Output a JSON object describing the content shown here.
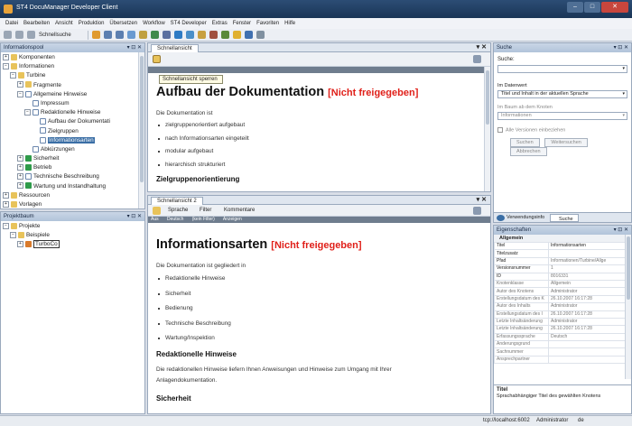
{
  "window": {
    "title": "ST4 DocuManager Developer Client"
  },
  "menu": [
    "Datei",
    "Bearbeiten",
    "Ansicht",
    "Produktion",
    "Übersetzen",
    "Workflow",
    "ST4 Developer",
    "Extras",
    "Fenster",
    "Favoriten",
    "Hilfe"
  ],
  "toolbar": {
    "label": "Schnellsuche"
  },
  "infopool": {
    "title": "Informationspool",
    "controls": "▾ ⊡ ✕",
    "items": [
      {
        "label": "Komponenten"
      },
      {
        "label": "Informationen"
      },
      {
        "label": "Turbine"
      },
      {
        "label": "Fragmente"
      },
      {
        "label": "Allgemeine Hinweise"
      },
      {
        "label": "Impressum"
      },
      {
        "label": "Redaktionelle Hinweise"
      },
      {
        "label": "Aufbau der Dokumentati"
      },
      {
        "label": "Zielgruppen"
      },
      {
        "label": "Informationsarten"
      },
      {
        "label": "Abkürzungen"
      },
      {
        "label": "Sicherheit"
      },
      {
        "label": "Betrieb"
      },
      {
        "label": "Technische Beschreibung"
      },
      {
        "label": "Wartung und Instandhaltung"
      },
      {
        "label": "Ressourcen"
      },
      {
        "label": "Vorlagen"
      }
    ]
  },
  "projektbaum": {
    "title": "Projektbaum",
    "items": [
      {
        "label": "Projekte"
      },
      {
        "label": "Beispiele"
      },
      {
        "label": "TurboCo"
      }
    ]
  },
  "view1": {
    "tab": "Schnellansicht",
    "tooltip": "Schnellansicht sperren",
    "heading": "Aufbau der Dokumentation",
    "status": "[Nicht freigegeben]",
    "intro": "Die Dokumentation ist",
    "bullets": [
      "zielgruppenorientiert aufgebaut",
      "nach Informationsarten eingeteilt",
      "modular aufgebaut",
      "hierarchisch strukturiert"
    ],
    "cut": "Zielgruppenorientierung"
  },
  "view2": {
    "tab": "Schnellansicht 2",
    "toolbar": [
      "Sprache",
      "Filter",
      "Kommentare"
    ],
    "bar": [
      "Aus",
      "Deutsch",
      "(kein Filter)",
      "Anzeigen"
    ],
    "heading": "Informationsarten",
    "status": "[Nicht freigegeben]",
    "intro": "Die Dokumentation ist gegliedert in",
    "bullets": [
      "Redaktionelle Hinweise",
      "Sicherheit",
      "Bedienung",
      "Technische Beschreibung",
      "Wartung/Inspektion"
    ],
    "h2a": "Redaktionelle Hinweise",
    "p2": "Die redaktionellen Hinweise liefern Ihnen Anweisungen und Hinweise zum Umgang mit Ihrer Anlagendokumentation.",
    "h2b": "Sicherheit"
  },
  "search": {
    "title": "Suche",
    "label": "Suche:",
    "in_data": "Im Datenwert",
    "data_option": "Titel und Inhalt in der aktuellen Sprache",
    "in_tree": "Im Baum ab dem Knoten",
    "tree_value": "Informationen",
    "all_versions": "Alle Versionen einbeziehen",
    "btn_search": "Suchen",
    "btn_continue": "Weitersuchen",
    "btn_abort": "Abbrechen",
    "tab_usage": "Verwendungsinfo",
    "tab_search": "Suche"
  },
  "props": {
    "title": "Eigenschaften",
    "group": "Allgemein",
    "rows": [
      {
        "k": "Titel",
        "v": "Informationsarten"
      },
      {
        "k": "Titelzusatz",
        "v": ""
      },
      {
        "k": "Pfad",
        "v": "Informationen/Turbine/Allge"
      },
      {
        "k": "Versionsnummer",
        "v": "1"
      },
      {
        "k": "ID",
        "v": "8016331"
      },
      {
        "k": "Knotenklasse",
        "v": "Allgemein"
      },
      {
        "k": "Autor des Knotens",
        "v": "Administrator"
      },
      {
        "k": "Erstellungsdatum des K",
        "v": "26.10.2007 16:17:28"
      },
      {
        "k": "Autor des Inhalts",
        "v": "Administrator"
      },
      {
        "k": "Erstellungsdatum des I",
        "v": "26.10.2007 16:17:28"
      },
      {
        "k": "Letzte Inhaltsänderung",
        "v": "Administrator"
      },
      {
        "k": "Letzte Inhaltsänderung",
        "v": "26.10.2007 16:17:28"
      },
      {
        "k": "Erfassungssprache",
        "v": "Deutsch"
      },
      {
        "k": "Änderungsgrund",
        "v": ""
      },
      {
        "k": "Sachnummer",
        "v": ""
      },
      {
        "k": "Ansprechpartner",
        "v": ""
      }
    ],
    "desc_title": "Titel",
    "desc_text": "Sprachabhängiger Titel des gewählten Knotens"
  },
  "status": {
    "server": "tcp://localhost:6002",
    "user": "Administrator",
    "lang": "de"
  },
  "colors": {
    "accent": "#3a6ea5",
    "not_released": "#e0201a"
  }
}
